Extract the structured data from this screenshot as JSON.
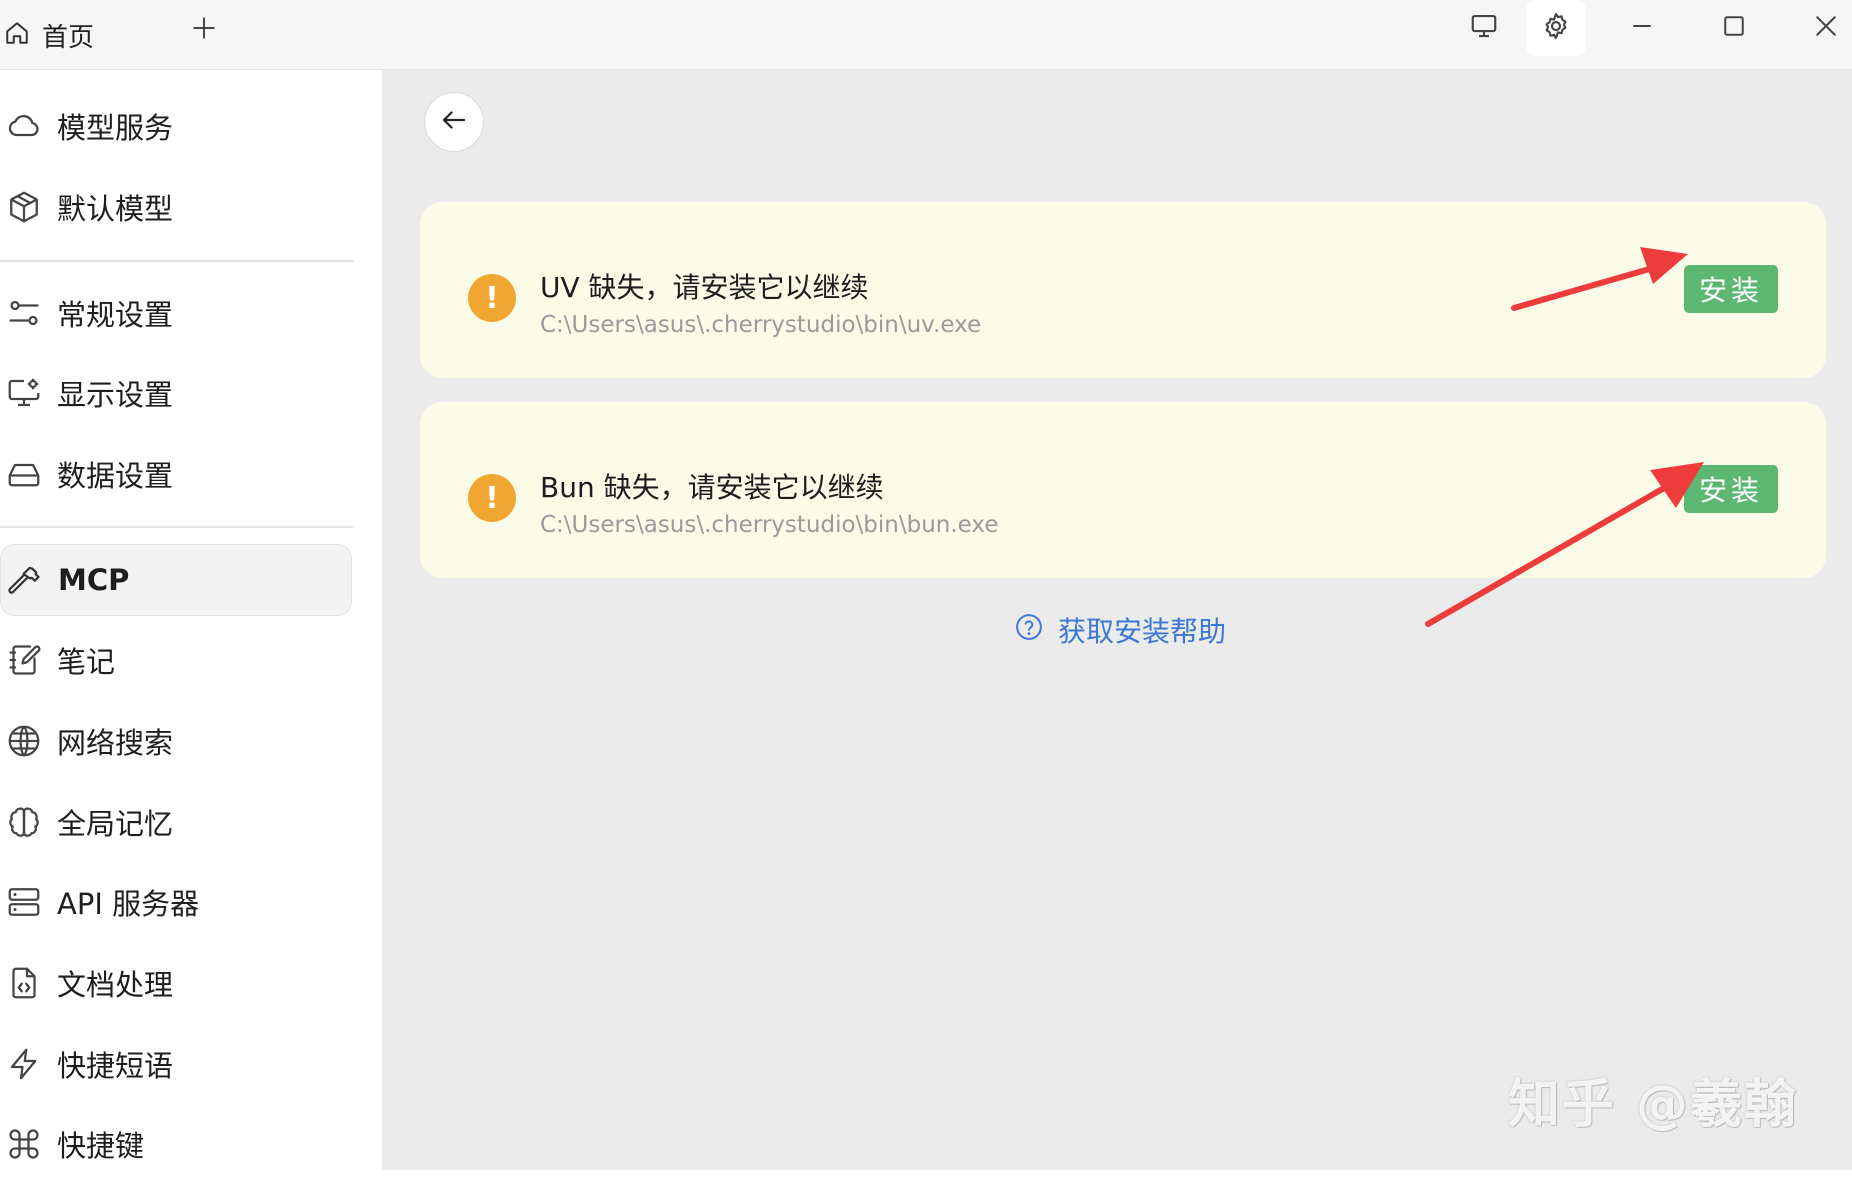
{
  "titlebar": {
    "home_tab_label": "首页",
    "home_icon": "home-icon",
    "add_icon": "plus-icon",
    "buttons": [
      "monitor-icon",
      "gear-icon",
      "minimize-icon",
      "maximize-icon",
      "close-icon"
    ]
  },
  "sidebar": {
    "items": [
      {
        "label": "模型服务",
        "icon": "cloud-icon"
      },
      {
        "label": "默认模型",
        "icon": "cube-icon"
      },
      {
        "label": "常规设置",
        "icon": "sliders-icon"
      },
      {
        "label": "显示设置",
        "icon": "display-settings-icon"
      },
      {
        "label": "数据设置",
        "icon": "hard-drive-icon"
      },
      {
        "label": "MCP",
        "icon": "hammer-icon",
        "active": true
      },
      {
        "label": "笔记",
        "icon": "notebook-icon"
      },
      {
        "label": "网络搜索",
        "icon": "globe-icon"
      },
      {
        "label": "全局记忆",
        "icon": "brain-icon"
      },
      {
        "label": "API 服务器",
        "icon": "server-icon"
      },
      {
        "label": "文档处理",
        "icon": "file-code-icon"
      },
      {
        "label": "快捷短语",
        "icon": "zap-icon"
      },
      {
        "label": "快捷键",
        "icon": "command-icon"
      }
    ]
  },
  "main": {
    "back_icon": "arrow-left-icon",
    "cards": [
      {
        "title": "UV 缺失，请安装它以继续",
        "path": "C:\\Users\\asus\\.cherrystudio\\bin\\uv.exe",
        "button": "安装"
      },
      {
        "title": "Bun 缺失，请安装它以继续",
        "path": "C:\\Users\\asus\\.cherrystudio\\bin\\bun.exe",
        "button": "安装"
      }
    ],
    "help_link": "获取安装帮助"
  },
  "watermark": "知乎 @羲翰",
  "colors": {
    "warning": "#f0a630",
    "install_button": "#5cb772",
    "link": "#3a77d6",
    "card_bg": "#fcfbe8",
    "arrow": "#ee3b3b"
  }
}
